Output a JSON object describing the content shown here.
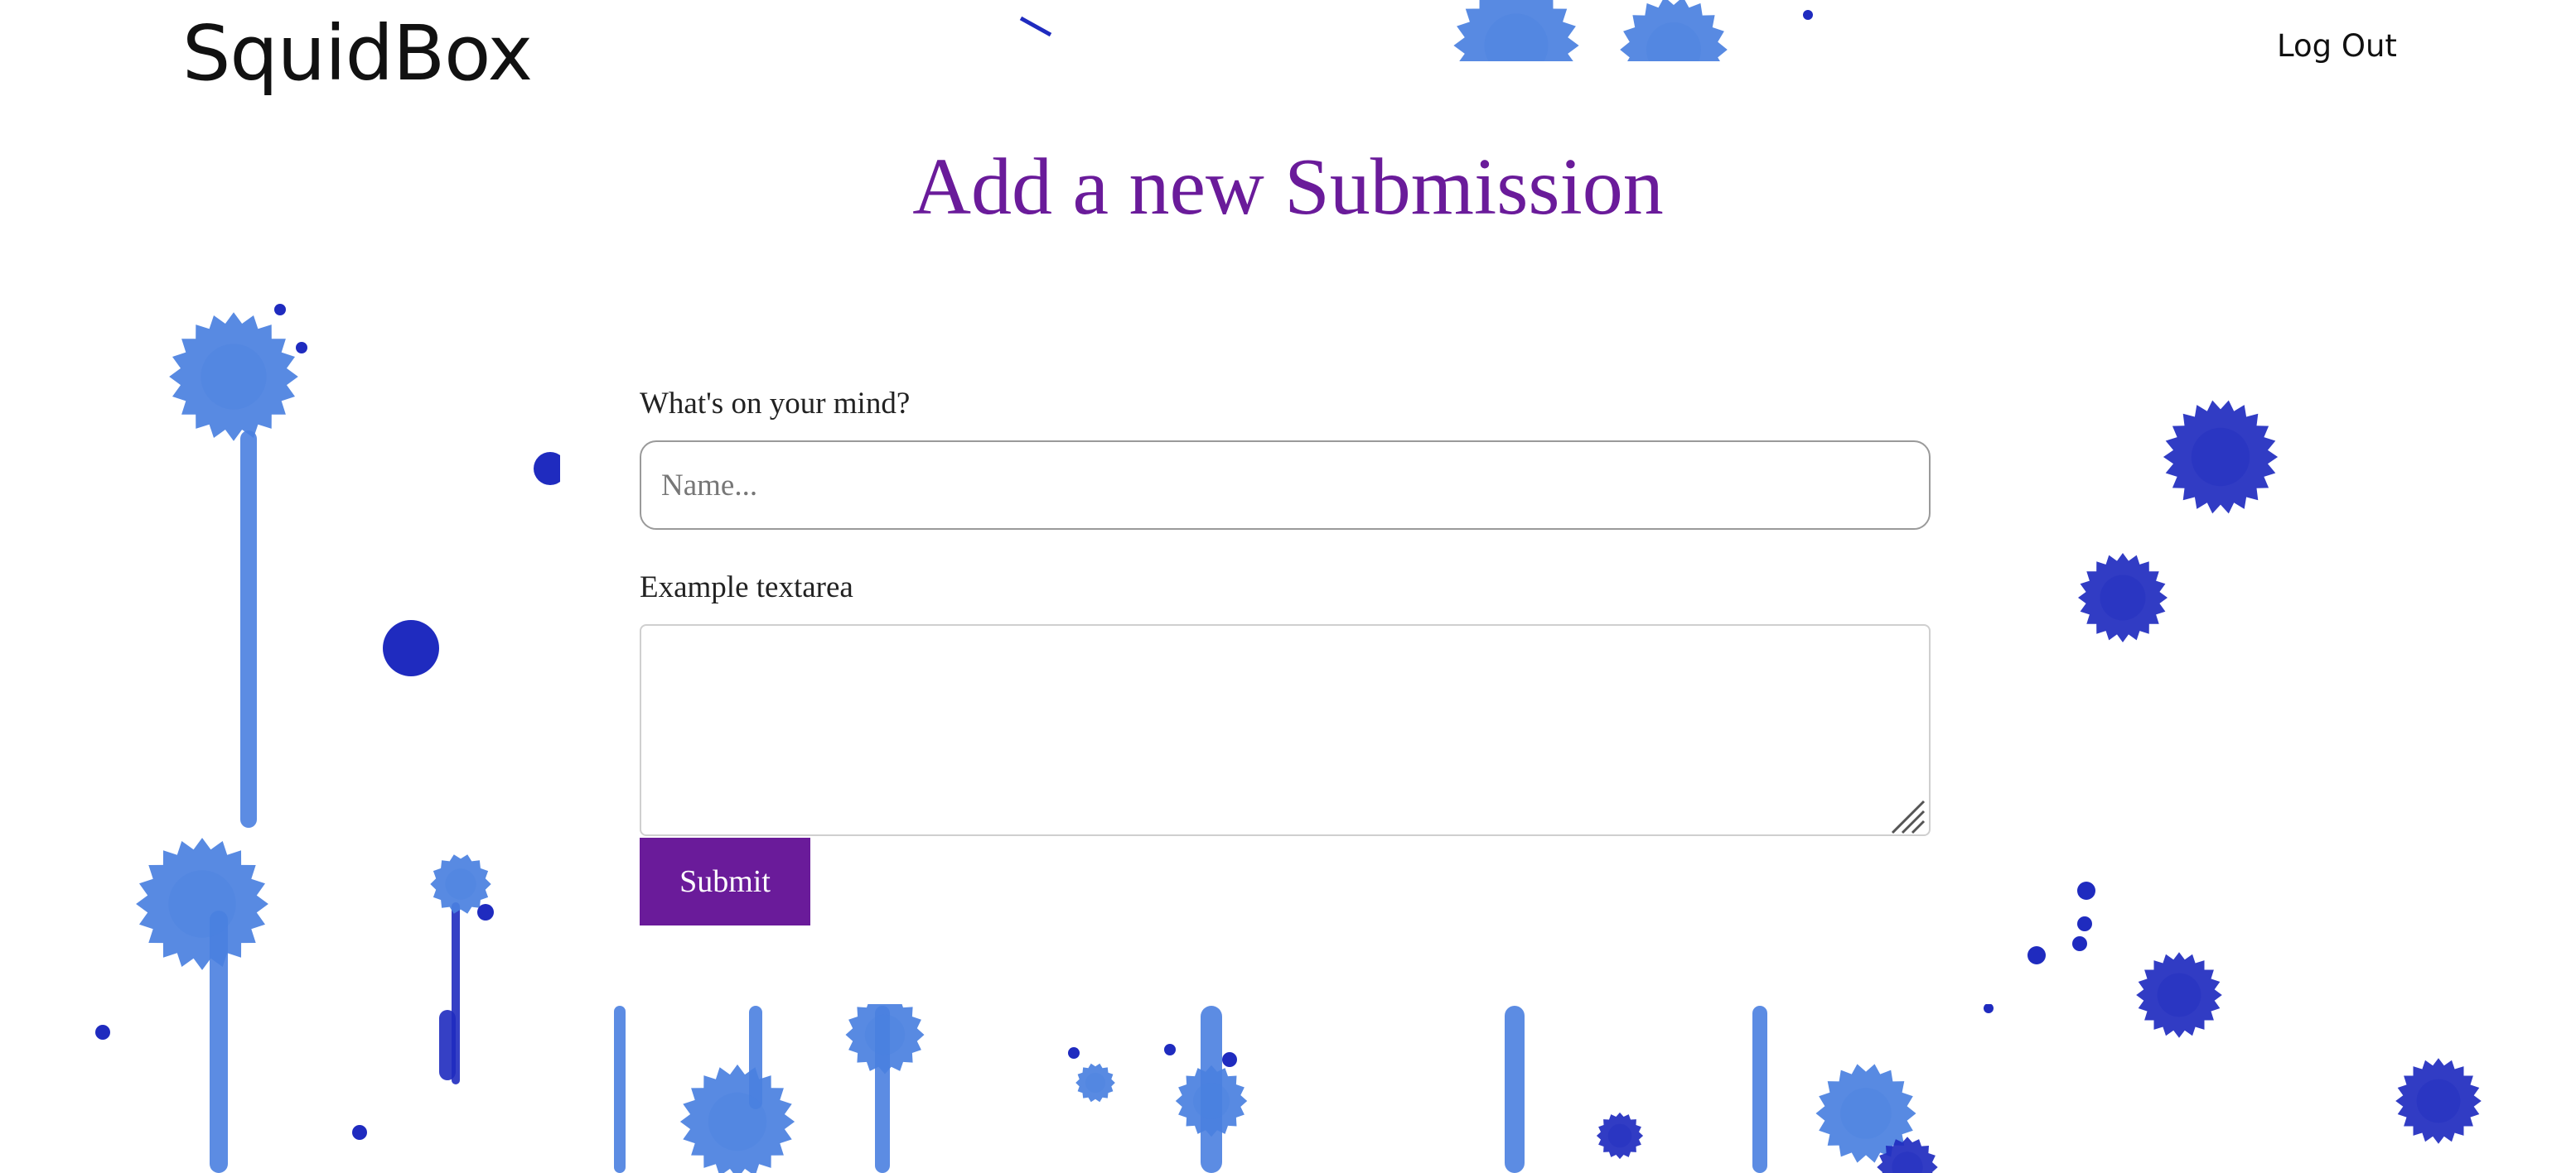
{
  "header": {
    "brand": "SquidBox",
    "logout_label": "Log Out"
  },
  "main": {
    "title": "Add a new Submission",
    "title_color": "#6a1b9a"
  },
  "form": {
    "mind_label": "What's on your mind?",
    "name_placeholder": "Name...",
    "name_value": "",
    "textarea_label": "Example textarea",
    "textarea_value": "",
    "submit_label": "Submit",
    "submit_color": "#6a1b9a"
  },
  "theme": {
    "ink_light": "#4a80e0",
    "ink_dark": "#1f2bbf"
  }
}
